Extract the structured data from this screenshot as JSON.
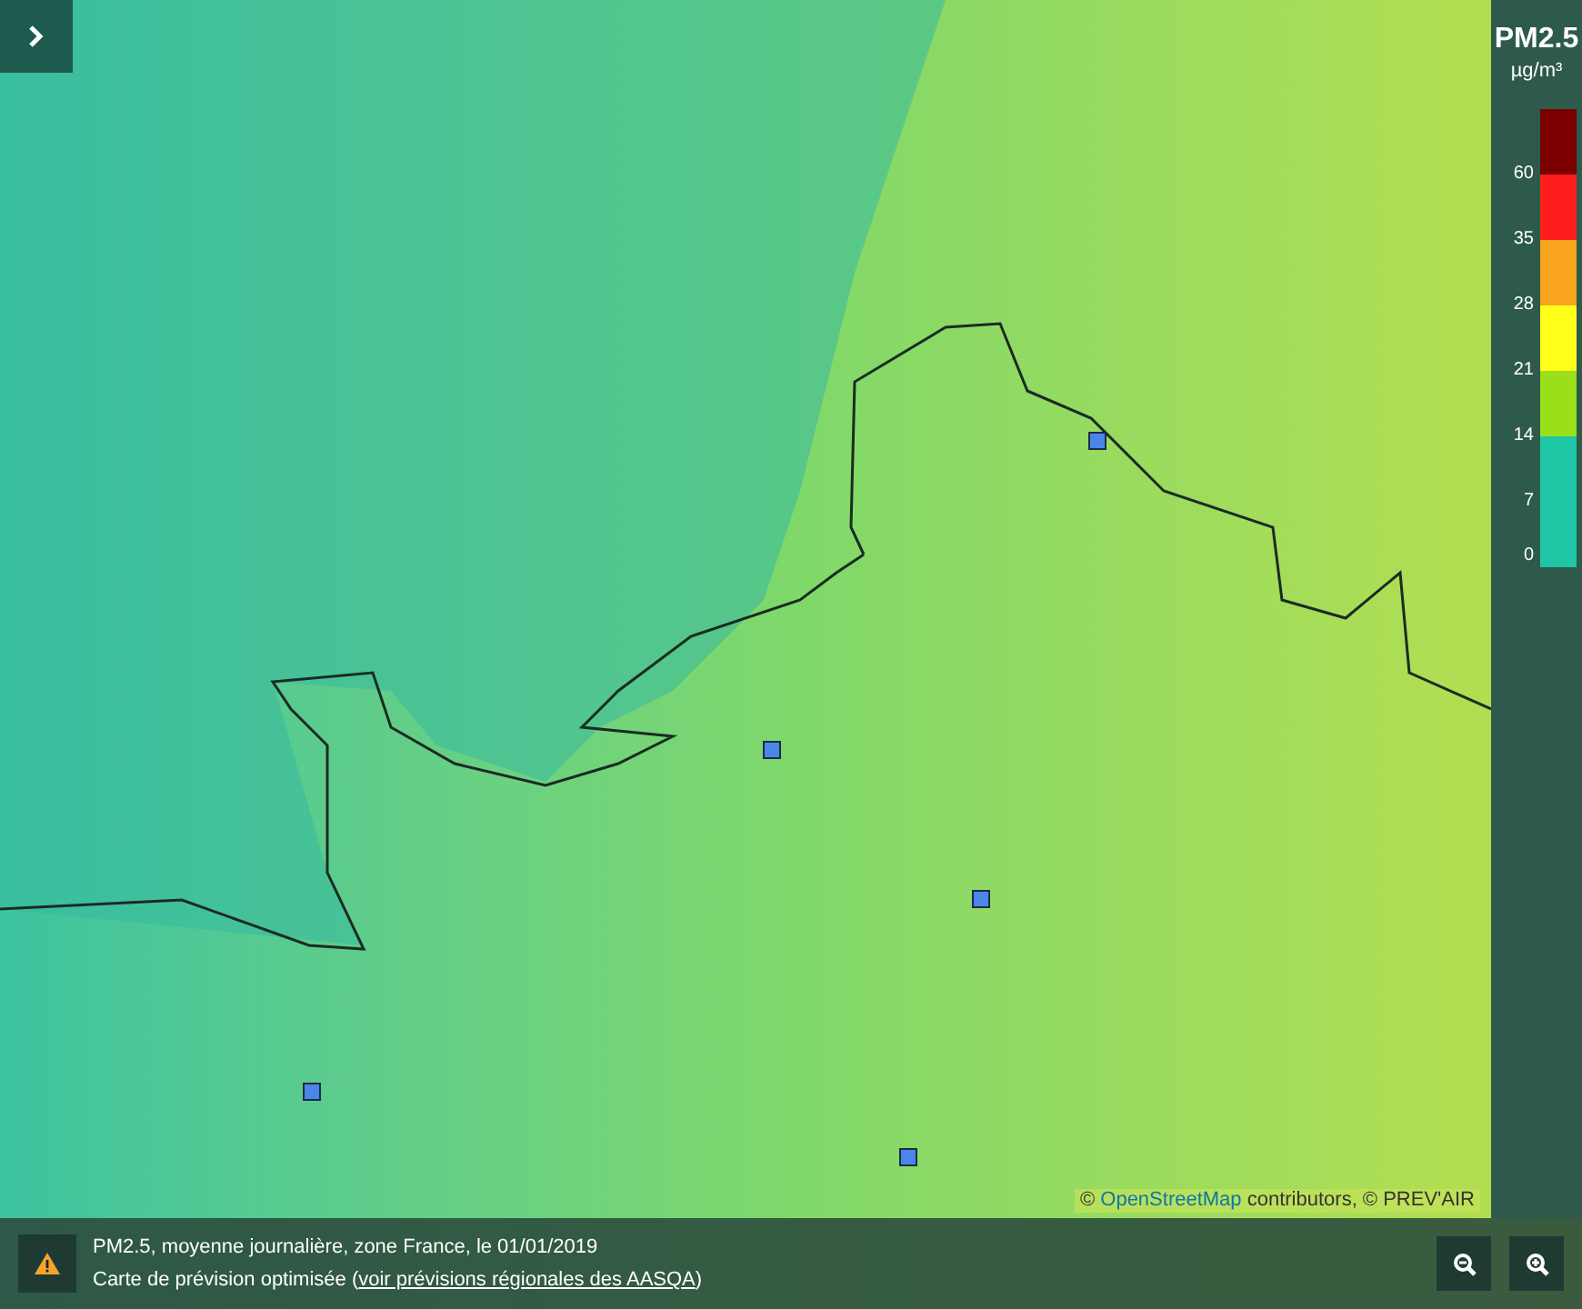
{
  "legend": {
    "title": "PM2.5",
    "unit": "µg/m³",
    "bands": [
      {
        "color": "#7d0000"
      },
      {
        "color": "#ff1e1e"
      },
      {
        "color": "#f9a31e"
      },
      {
        "color": "#ffff1a"
      },
      {
        "color": "#99e01a"
      },
      {
        "color": "#1fc6a6"
      },
      {
        "color": "#1fc6a6"
      }
    ],
    "ticks": [
      "60",
      "35",
      "28",
      "21",
      "14",
      "7",
      "0"
    ]
  },
  "attribution": {
    "before": "© ",
    "link": "OpenStreetMap",
    "after": " contributors, © PREV'AIR"
  },
  "info": {
    "line_1": "PM2.5, moyenne journalière, zone France, le 01/01/2019",
    "line_2_before": "Carte de prévision optimisée (",
    "line_2_link": "voir prévisions régionales des AASQA",
    "line_2_after": ")"
  }
}
